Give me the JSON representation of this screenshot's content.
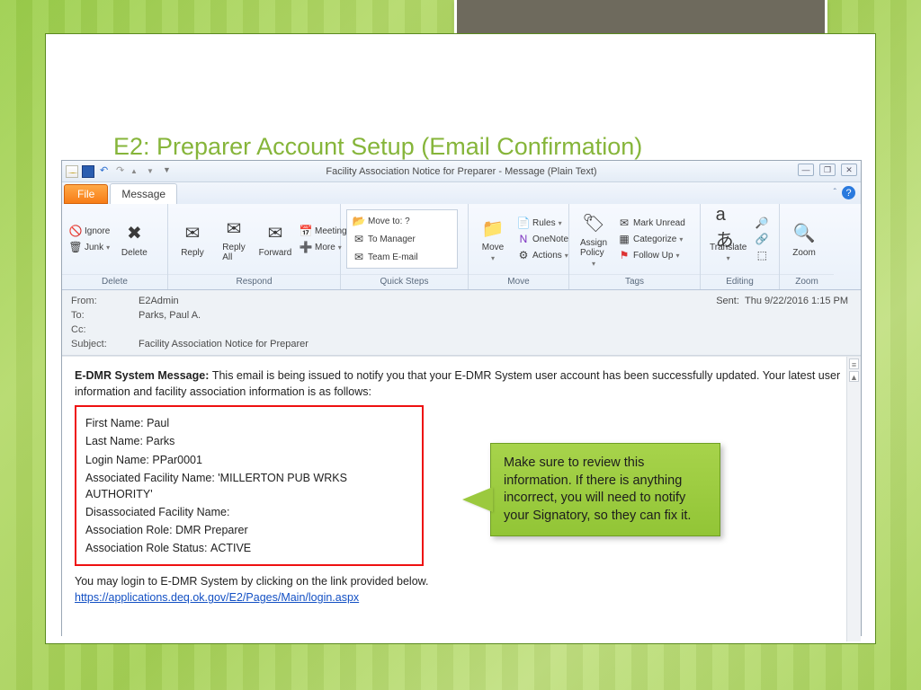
{
  "slide": {
    "title": "E2: Preparer Account Setup (Email Confirmation)"
  },
  "outlook": {
    "windowTitle": "Facility Association Notice for Preparer  -  Message (Plain Text)",
    "tabs": {
      "file": "File",
      "message": "Message"
    },
    "groups": {
      "delete": {
        "label": "Delete",
        "ignore": "Ignore",
        "junk": "Junk",
        "delete": "Delete"
      },
      "respond": {
        "label": "Respond",
        "reply": "Reply",
        "replyAll": "Reply\nAll",
        "forward": "Forward",
        "meeting": "Meeting",
        "more": "More"
      },
      "quicksteps": {
        "label": "Quick Steps",
        "moveto": "Move to: ?",
        "toManager": "To Manager",
        "teamEmail": "Team E-mail"
      },
      "move": {
        "label": "Move",
        "move": "Move",
        "rules": "Rules",
        "onenote": "OneNote",
        "actions": "Actions"
      },
      "tags": {
        "label": "Tags",
        "assign": "Assign\nPolicy",
        "unread": "Mark Unread",
        "categorize": "Categorize",
        "followup": "Follow Up"
      },
      "editing": {
        "label": "Editing",
        "translate": "Translate"
      },
      "zoom": {
        "label": "Zoom",
        "zoom": "Zoom"
      }
    },
    "headers": {
      "fromLabel": "From:",
      "from": "E2Admin",
      "toLabel": "To:",
      "to": "Parks, Paul A.",
      "ccLabel": "Cc:",
      "cc": "",
      "subjectLabel": "Subject:",
      "subject": "Facility Association Notice for Preparer",
      "sentLabel": "Sent:",
      "sent": "Thu 9/22/2016 1:15 PM"
    },
    "body": {
      "sysPrefix": "E-DMR System Message:",
      "sysText": "This email is being issued to notify you that your E-DMR System user account has been successfully updated.  Your latest user information and facility association information is as follows:",
      "fields": {
        "firstName": {
          "label": "First Name:",
          "value": "Paul"
        },
        "lastName": {
          "label": "Last Name:",
          "value": "Parks"
        },
        "loginName": {
          "label": "Login Name:",
          "value": "PPar0001"
        },
        "assocFacility": {
          "label": "Associated Facility Name:",
          "value": "'MILLERTON PUB WRKS AUTHORITY'"
        },
        "disassocFacility": {
          "label": "Disassociated Facility Name:",
          "value": ""
        },
        "role": {
          "label": "Association Role:",
          "value": "DMR Preparer"
        },
        "roleStatus": {
          "label": "Association Role Status:",
          "value": "ACTIVE"
        }
      },
      "loginPrompt": "You may login to E-DMR System by clicking on the link provided below.",
      "loginUrl": "https://applications.deq.ok.gov/E2/Pages/Main/login.aspx"
    }
  },
  "callout": "Make sure to review this information. If there is anything incorrect, you will need to notify your Signatory, so they can fix it."
}
